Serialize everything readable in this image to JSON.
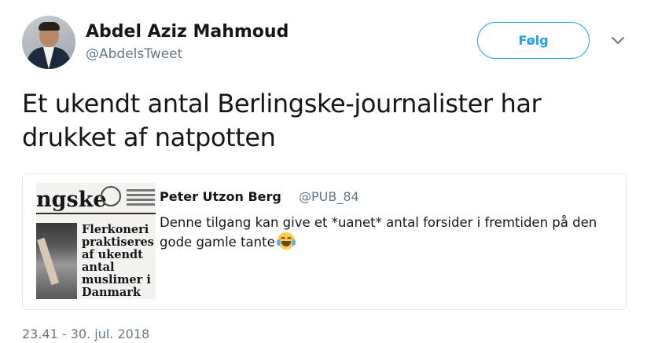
{
  "author": {
    "name": "Abdel Aziz Mahmoud",
    "handle": "@AbdelsTweet"
  },
  "follow_label": "Følg",
  "tweet_text": "Et ukendt antal Berlingske-journalister har drukket af natpotten",
  "quoted": {
    "name": "Peter Utzon Berg",
    "handle": "@PUB_84",
    "text": "Denne tilgang kan give et *uanet* antal forsider i fremtiden på den gode gamle tante",
    "emoji": "face-with-tears-of-joy",
    "thumbnail": {
      "masthead": "ngske",
      "headline": "Flerkoneri praktiseres af ukendt antal muslimer i Danmark"
    }
  },
  "timestamp": "23.41 - 30. jul. 2018",
  "colors": {
    "accent": "#1da1f2",
    "secondary_text": "#657786",
    "border": "#e1e8ed"
  }
}
